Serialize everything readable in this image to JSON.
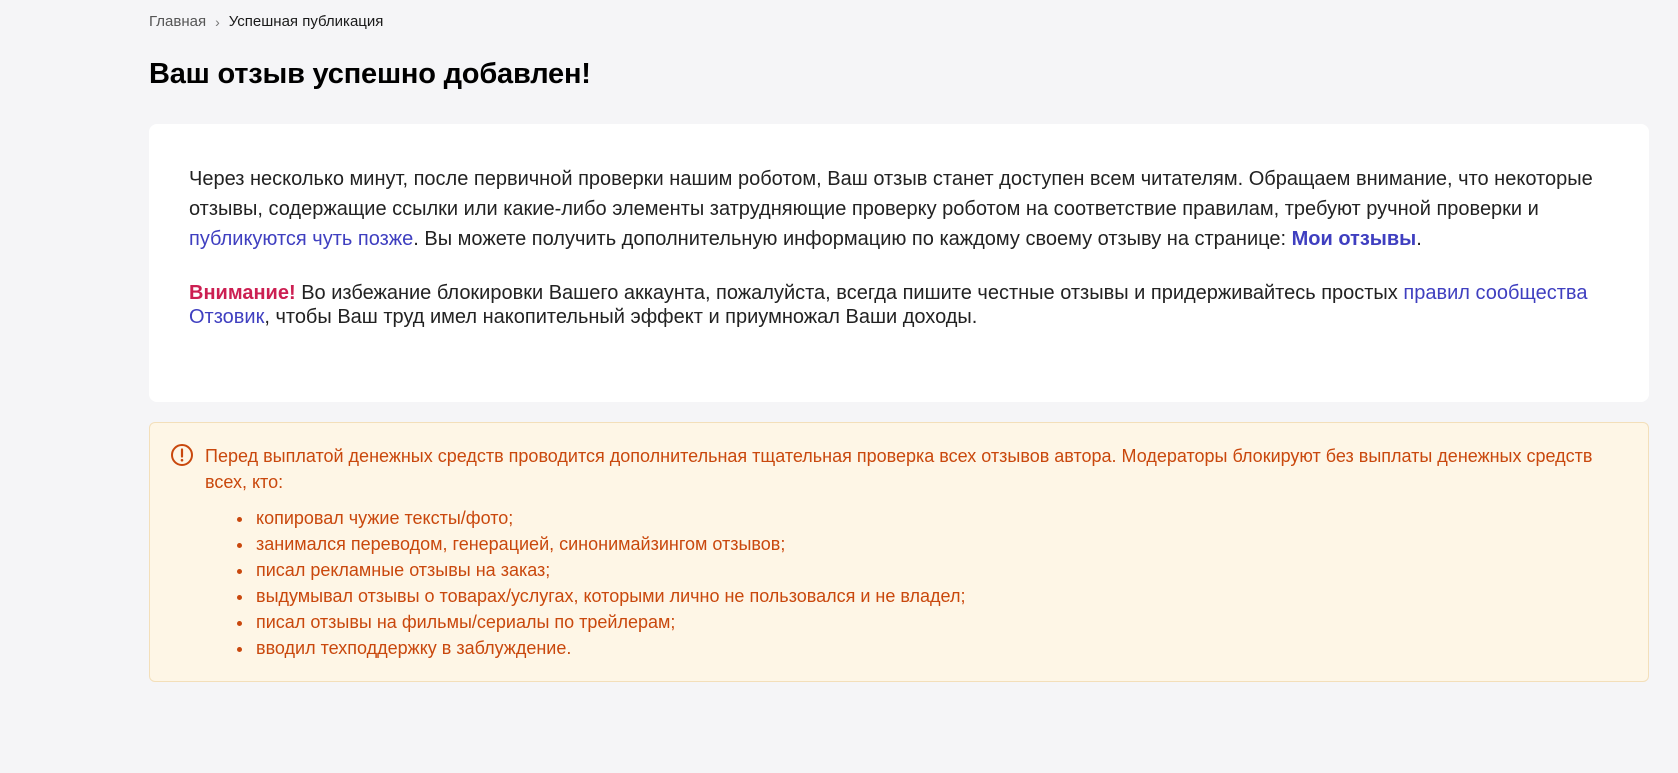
{
  "breadcrumb": {
    "home": "Главная",
    "separator": "›",
    "current": "Успешная публикация"
  },
  "title": "Ваш отзыв успешно добавлен!",
  "info": {
    "text_1": "Через несколько минут, после первичной проверки нашим роботом, Ваш отзыв станет доступен всем читателям. Обращаем внимание, что некоторые отзывы, содержащие ссылки или какие-либо элементы затрудняющие проверку роботом на соответствие правилам, требуют ручной проверки и ",
    "link_later": "публикуются чуть позже",
    "text_2": ". Вы можете получить дополнительную информацию по каждому своему отзыву на странице: ",
    "link_my_reviews": "Мои отзывы",
    "text_3": "."
  },
  "warning": {
    "label": "Внимание!",
    "text_1": " Во избежание блокировки Вашего аккаунта, пожалуйста, всегда пишите честные отзывы и придерживайтесь простых ",
    "link_rules": "правил сообщества Отзовик",
    "text_2": ", чтобы Ваш труд имел накопительный эффект и приумножал Ваши доходы."
  },
  "notice": {
    "icon": "exclamation-circle-icon",
    "color": "#c9480d",
    "text": "Перед выплатой денежных средств проводится дополнительная тщательная проверка всех отзывов автора. Модераторы блокируют без выплаты денежных средств всех, кто:",
    "items": [
      "копировал чужие тексты/фото;",
      "занимался переводом, генерацией, синонимайзингом отзывов;",
      "писал рекламные отзывы на заказ;",
      "выдумывал отзывы о товарах/услугах, которыми лично не пользовался и не владел;",
      "писал отзывы на фильмы/сериалы по трейлерам;",
      "вводил техподдержку в заблуждение."
    ]
  }
}
